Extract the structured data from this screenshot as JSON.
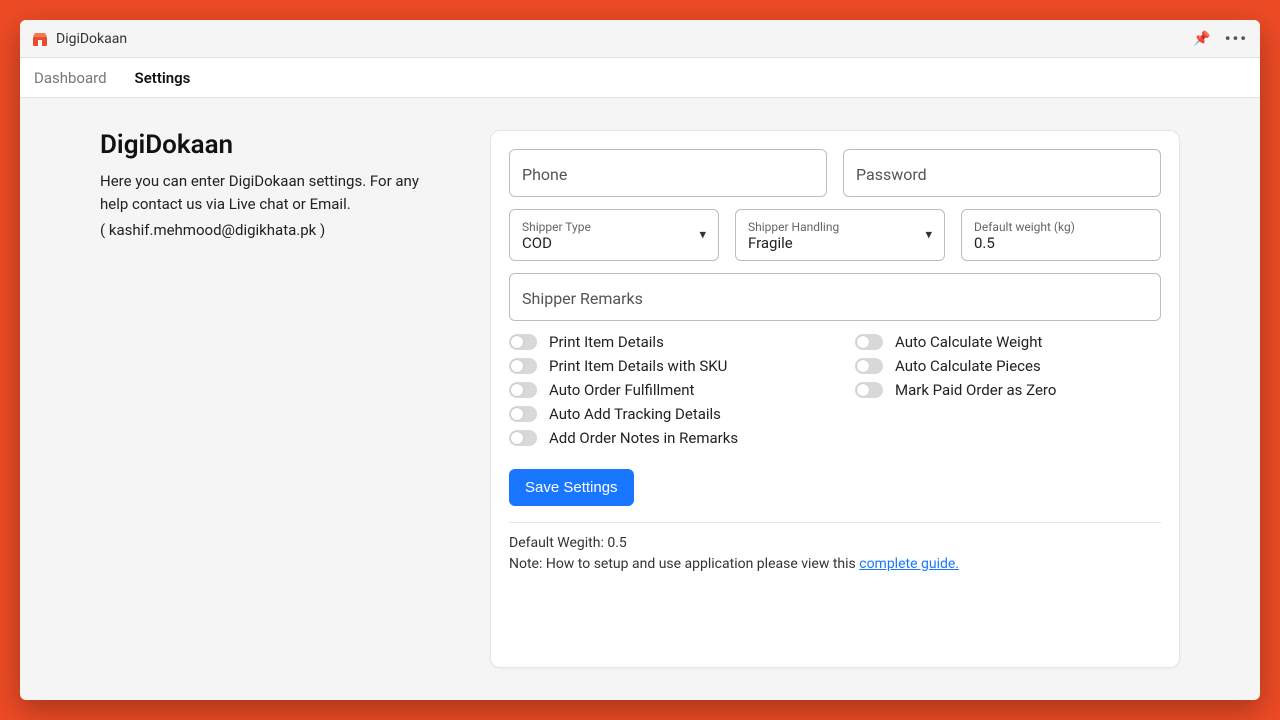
{
  "window": {
    "title": "DigiDokaan"
  },
  "tabs": {
    "dashboard": "Dashboard",
    "settings": "Settings"
  },
  "left": {
    "title": "DigiDokaan",
    "desc": "Here you can enter DigiDokaan settings. For any help contact us via Live chat or Email.",
    "email": "( kashif.mehmood@digikhata.pk )"
  },
  "form": {
    "phone_placeholder": "Phone",
    "password_placeholder": "Password",
    "shipper_type_label": "Shipper Type",
    "shipper_type_value": "COD",
    "shipper_handling_label": "Shipper Handling",
    "shipper_handling_value": "Fragile",
    "default_weight_label": "Default weight (kg)",
    "default_weight_value": "0.5",
    "shipper_remarks_placeholder": "Shipper Remarks"
  },
  "toggles_left": [
    "Print Item Details",
    "Print Item Details with SKU",
    "Auto Order Fulfillment",
    "Auto Add Tracking Details",
    "Add Order Notes in Remarks"
  ],
  "toggles_right": [
    "Auto Calculate Weight",
    "Auto Calculate Pieces",
    "Mark Paid Order as Zero"
  ],
  "save_label": "Save Settings",
  "footer": {
    "line1": "Default Wegith: 0.5",
    "note_prefix": "Note: How to setup and use application please view this ",
    "link_text": "complete guide."
  }
}
